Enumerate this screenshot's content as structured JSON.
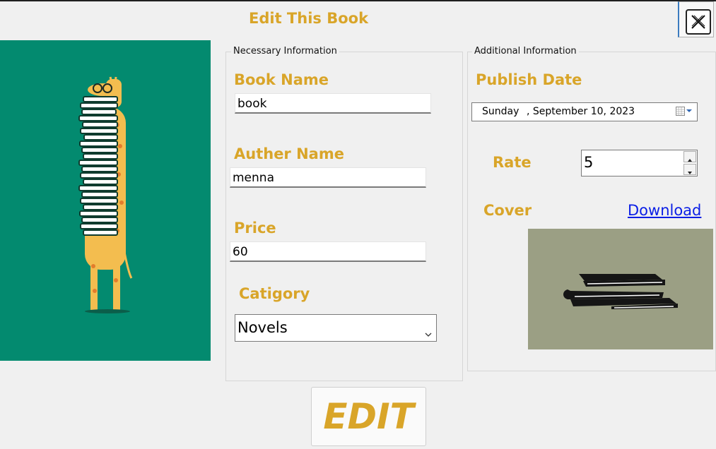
{
  "window": {
    "title": "Edit This Book"
  },
  "colors": {
    "accent_gold": "#d9a529",
    "side_art_bg": "#038a6f",
    "cover_bg": "#9b9f84",
    "link": "#0a1ee6"
  },
  "necessary_info": {
    "legend": "Necessary Information",
    "book_name_label": "Book Name",
    "book_name_value": "book",
    "author_name_label": "Auther Name",
    "author_name_value": "menna",
    "price_label": "Price",
    "price_value": "60",
    "category_label": "Catigory",
    "category_value": "Novels"
  },
  "additional_info": {
    "legend": "Additional Information",
    "publish_date_label": "Publish Date",
    "publish_date_day": "Sunday",
    "publish_date_rest": ", September 10, 2023",
    "rate_label": "Rate",
    "rate_value": "5",
    "cover_label": "Cover",
    "download_link": "Download"
  },
  "actions": {
    "edit_label": "EDIT"
  },
  "icons": {
    "close": "close-icon",
    "calendar": "calendar-icon",
    "combo_arrow": "chevron-down-icon",
    "spin_up": "spin-up-icon",
    "spin_down": "spin-down-icon"
  }
}
